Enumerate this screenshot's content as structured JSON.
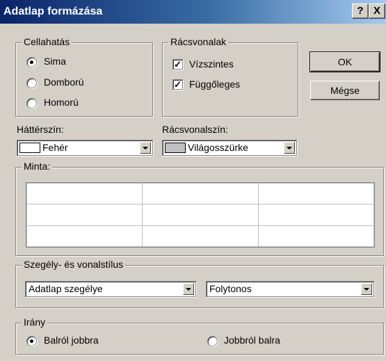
{
  "window": {
    "title": "Adatlap formázása",
    "help_button": "?",
    "close_button": "X"
  },
  "cell_effect": {
    "legend": "Cellahatás",
    "options": [
      {
        "label": "Sima",
        "selected": true
      },
      {
        "label": "Domború",
        "selected": false
      },
      {
        "label": "Homorú",
        "selected": false
      }
    ]
  },
  "gridlines": {
    "legend": "Rácsvonalak",
    "options": [
      {
        "label": "Vízszintes",
        "checked": true
      },
      {
        "label": "Függőleges",
        "checked": true
      }
    ]
  },
  "buttons": {
    "ok": "OK",
    "cancel": "Mégse"
  },
  "background_color": {
    "label": "Háttérszín:",
    "value": "Fehér",
    "swatch": "#ffffff"
  },
  "gridline_color": {
    "label": "Rácsvonalszín:",
    "value": "Világosszürke",
    "swatch": "#c0c0c0"
  },
  "sample": {
    "legend": "Minta:"
  },
  "border_style": {
    "legend": "Szegély- és vonalstílus",
    "border_value": "Adatlap szegélye",
    "line_value": "Folytonos"
  },
  "direction": {
    "legend": "Irány",
    "options": [
      {
        "label": "Balról jobbra",
        "selected": true
      },
      {
        "label": "Jobbról balra",
        "selected": false
      }
    ]
  }
}
